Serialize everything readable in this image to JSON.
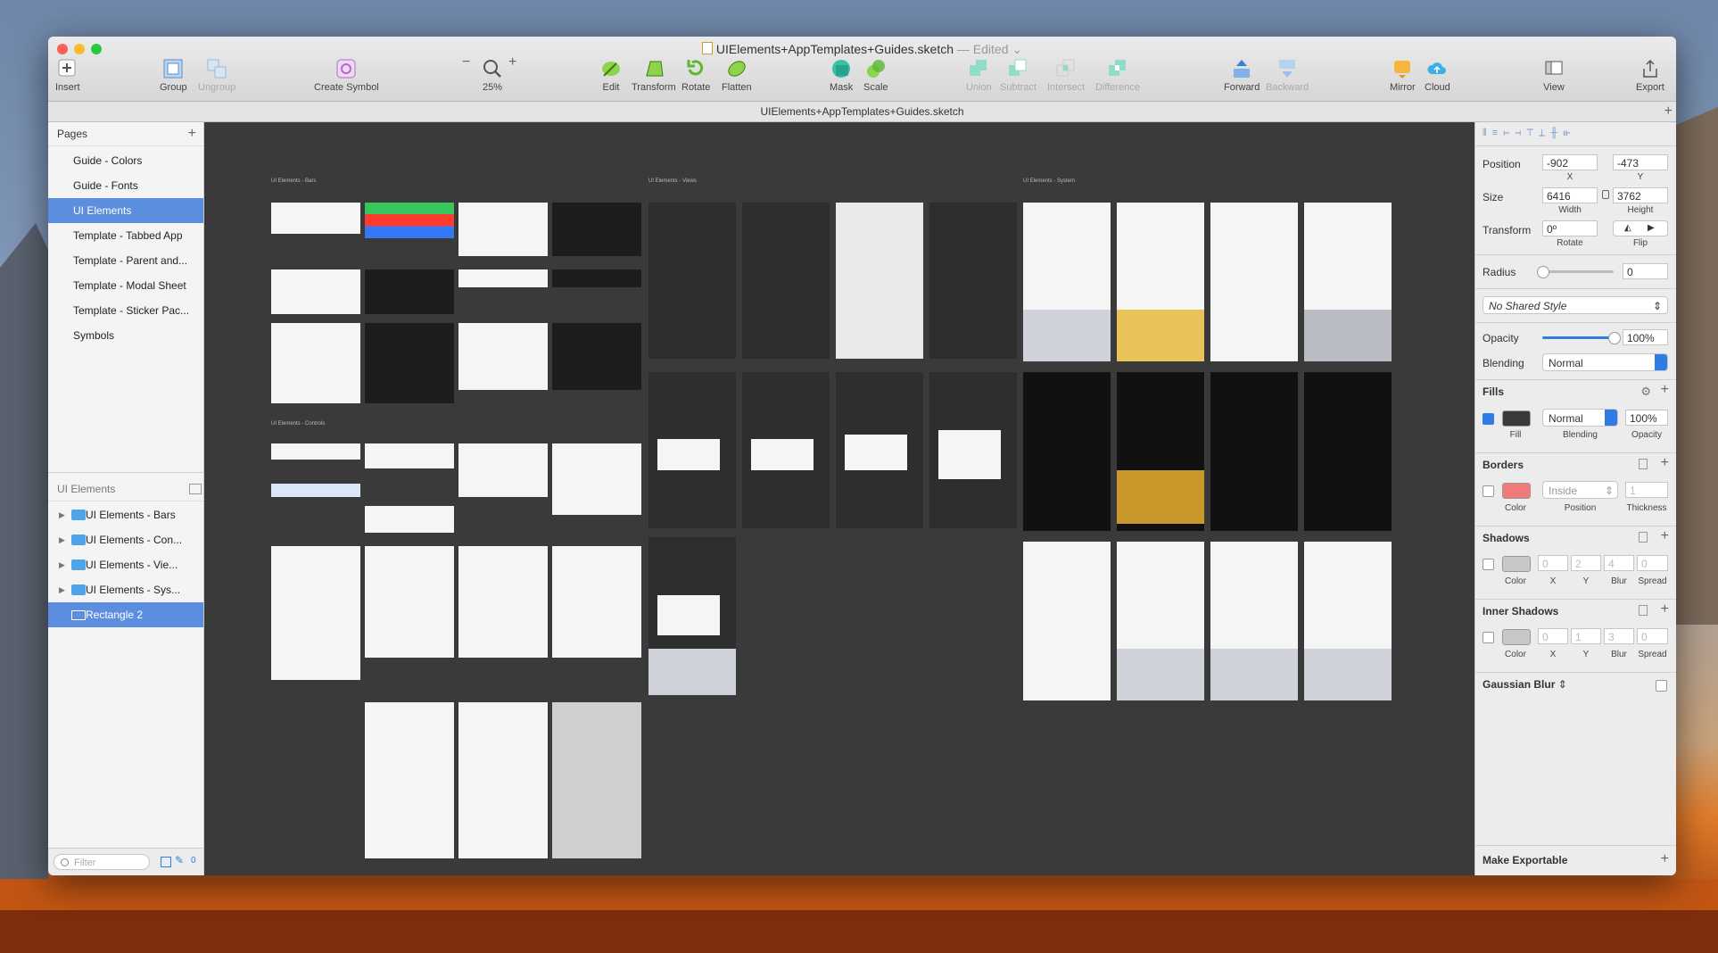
{
  "window": {
    "file_name": "UIElements+AppTemplates+Guides.sketch",
    "edited_label": "— Edited ⌄",
    "subtitle": "UIElements+AppTemplates+Guides.sketch"
  },
  "toolbar": {
    "insert": "Insert",
    "group": "Group",
    "ungroup": "Ungroup",
    "create_symbol": "Create Symbol",
    "zoom": "25%",
    "edit": "Edit",
    "transform": "Transform",
    "rotate": "Rotate",
    "flatten": "Flatten",
    "mask": "Mask",
    "scale": "Scale",
    "union": "Union",
    "subtract": "Subtract",
    "intersect": "Intersect",
    "difference": "Difference",
    "forward": "Forward",
    "backward": "Backward",
    "mirror": "Mirror",
    "cloud": "Cloud",
    "view": "View",
    "export": "Export",
    "zoom_minus": "−",
    "zoom_plus": "+"
  },
  "sidebar": {
    "pages_header": "Pages",
    "pages": [
      "Guide - Colors",
      "Guide - Fonts",
      "UI Elements",
      "Template - Tabbed App",
      "Template - Parent and...",
      "Template - Modal Sheet",
      "Template - Sticker Pac...",
      "Symbols"
    ],
    "layers_header": "UI Elements",
    "layers": [
      "UI Elements - Bars",
      "UI Elements - Con...",
      "UI Elements - Vie...",
      "UI Elements - Sys...",
      "Rectangle 2"
    ],
    "filter_placeholder": "Filter",
    "filter_count": "0"
  },
  "canvas": {
    "label_bars": "UI Elements - Bars",
    "label_views": "UI Elements - Views",
    "label_system": "UI Elements - System",
    "label_controls": "UI Elements - Controls"
  },
  "inspector": {
    "position_label": "Position",
    "x_value": "-902",
    "y_value": "-473",
    "x_label": "X",
    "y_label": "Y",
    "size_label": "Size",
    "width_value": "6416",
    "height_value": "3762",
    "width_label": "Width",
    "height_label": "Height",
    "transform_label": "Transform",
    "rotate_value": "0º",
    "rotate_label": "Rotate",
    "flip_label": "Flip",
    "radius_label": "Radius",
    "radius_value": "0",
    "radius_level": 0,
    "shared_style": "No Shared Style",
    "opacity_label": "Opacity",
    "opacity_value": "100%",
    "blending_label": "Blending",
    "blending_value": "Normal",
    "fills_header": "Fills",
    "fill_blend": "Normal",
    "fill_opacity": "100%",
    "fill_label": "Fill",
    "fill_blending_label": "Blending",
    "fill_opacity_label": "Opacity",
    "fill_color": "#3a3a3a",
    "borders_header": "Borders",
    "border_position": "Inside",
    "border_thickness": "1",
    "border_color_label": "Color",
    "border_position_label": "Position",
    "border_thickness_label": "Thickness",
    "border_color": "#f07a7a",
    "shadows_header": "Shadows",
    "shadow_values": [
      "0",
      "2",
      "4",
      "0"
    ],
    "shadow_labels": [
      "Color",
      "X",
      "Y",
      "Blur",
      "Spread"
    ],
    "inner_shadows_header": "Inner Shadows",
    "inner_shadow_values": [
      "0",
      "1",
      "3",
      "0"
    ],
    "gaussian_blur": "Gaussian Blur",
    "make_exportable": "Make Exportable"
  }
}
